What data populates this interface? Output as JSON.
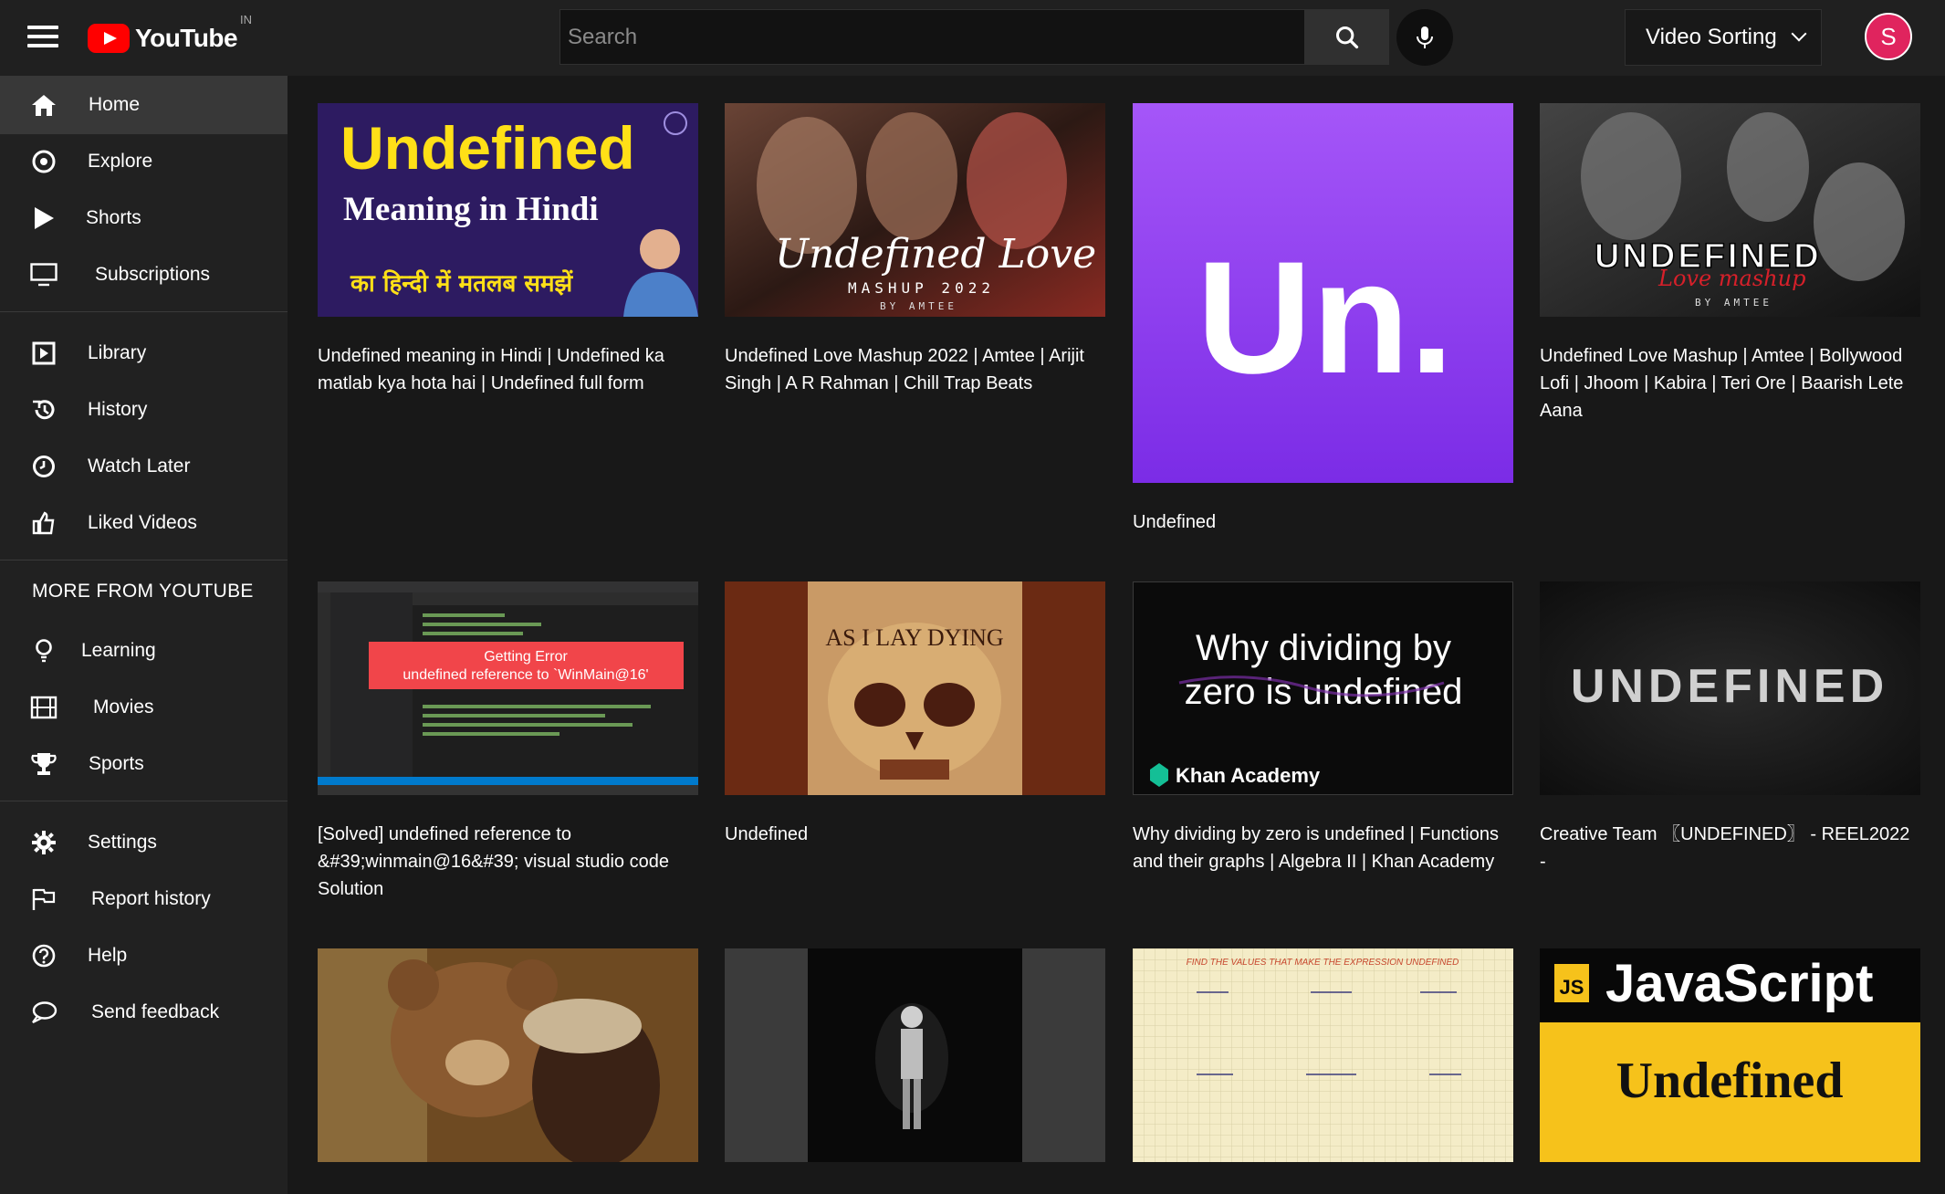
{
  "header": {
    "logo_text": "YouTube",
    "region": "IN",
    "search_placeholder": "Search",
    "sort_label": "Video Sorting",
    "avatar_initial": "S"
  },
  "sidebar": {
    "primary": [
      {
        "label": "Home",
        "icon": "home-icon",
        "active": true
      },
      {
        "label": "Explore",
        "icon": "compass-icon"
      },
      {
        "label": "Shorts",
        "icon": "play-icon"
      },
      {
        "label": "Subscriptions",
        "icon": "monitor-icon"
      }
    ],
    "library": [
      {
        "label": "Library",
        "icon": "library-icon"
      },
      {
        "label": "History",
        "icon": "history-icon"
      },
      {
        "label": "Watch Later",
        "icon": "clock-icon"
      },
      {
        "label": "Liked Videos",
        "icon": "thumbs-up-icon"
      }
    ],
    "more_heading": "MORE FROM YOUTUBE",
    "more": [
      {
        "label": "Learning",
        "icon": "lightbulb-icon"
      },
      {
        "label": "Movies",
        "icon": "film-icon"
      },
      {
        "label": "Sports",
        "icon": "trophy-icon"
      }
    ],
    "footer": [
      {
        "label": "Settings",
        "icon": "gear-icon"
      },
      {
        "label": "Report history",
        "icon": "flag-icon"
      },
      {
        "label": "Help",
        "icon": "help-icon"
      },
      {
        "label": "Send feedback",
        "icon": "feedback-icon"
      }
    ]
  },
  "thumb_text": {
    "t1_title": "Undefined",
    "t1_sub": "Meaning in Hindi",
    "t1_hindi": "का हिन्दी में मतलब समझें",
    "t2_title": "Undefined Love",
    "t2_sub": "MASHUP 2022",
    "t2_by": "BY AMTEE",
    "t3_big": "Un.",
    "t4_title": "UNDEFINED",
    "t4_sub": "Love mashup",
    "t4_by": "BY AMTEE",
    "t5_error1": "Getting Error",
    "t5_error2": "undefined reference to `WinMain@16'",
    "t6_band": "AS I LAY DYING",
    "t7_line1": "Why dividing by",
    "t7_line2": "zero is undefined",
    "t7_brand": "Khan Academy",
    "t8_title": "UNDEFINED",
    "t11_heading": "FIND THE VALUES THAT MAKE THE EXPRESSION UNDEFINED",
    "t12_js": "JavaScript",
    "t12_sub": "Undefined"
  },
  "videos": [
    {
      "title": "Undefined meaning in Hindi | Undefined ka matlab kya hota hai | Undefined full form"
    },
    {
      "title": "Undefined Love Mashup 2022 | Amtee | Arijit Singh | A R Rahman | Chill Trap Beats"
    },
    {
      "title": "Undefined"
    },
    {
      "title": "Undefined Love Mashup | Amtee | Bollywood Lofi | Jhoom | Kabira | Teri Ore | Baarish Lete Aana"
    },
    {
      "title": "[Solved] undefined reference to &#39;winmain@16&#39; visual studio code Solution"
    },
    {
      "title": "Undefined"
    },
    {
      "title": "Why dividing by zero is undefined | Functions and their graphs | Algebra II | Khan Academy"
    },
    {
      "title": "Creative Team 〖UNDEFINED〗 - REEL2022 -"
    }
  ],
  "colors": {
    "brand_red": "#ff0000",
    "background": "#181818",
    "sidebar": "#212121",
    "avatar": "#e0245e"
  }
}
